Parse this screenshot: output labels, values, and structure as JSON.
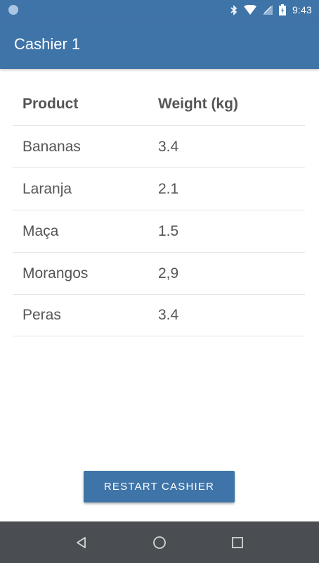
{
  "status_bar": {
    "time": "9:43",
    "icons": [
      "notification-dot-icon",
      "bluetooth-icon",
      "wifi-icon",
      "no-sim-icon",
      "battery-icon"
    ]
  },
  "app_bar": {
    "title": "Cashier 1"
  },
  "table": {
    "headers": [
      "Product",
      "Weight (kg)"
    ],
    "rows": [
      [
        "Bananas",
        "3.4"
      ],
      [
        "Laranja",
        "2.1"
      ],
      [
        "Maça",
        "1.5"
      ],
      [
        "Morangos",
        "2,9"
      ],
      [
        "Peras",
        "3.4"
      ]
    ]
  },
  "restart_button": {
    "label": "RESTART CASHIER"
  },
  "nav_bar": {
    "icons": [
      "back-icon",
      "home-icon",
      "recents-icon"
    ]
  },
  "colors": {
    "primary": "#3f74a8",
    "nav_bar": "#4a4e52",
    "text": "#555555",
    "divider": "#e3e3e3"
  }
}
